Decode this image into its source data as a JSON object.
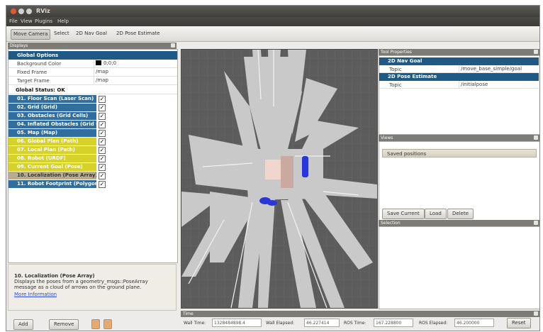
{
  "window": {
    "title": "RViz"
  },
  "menu": [
    "File",
    "View",
    "Plugins",
    "Help"
  ],
  "toolbar": [
    "Move Camera",
    "Select",
    "2D Nav Goal",
    "2D Pose Estimate"
  ],
  "displays_panel": {
    "header": "Displays",
    "global_options": {
      "label": "Global Options",
      "properties": [
        {
          "name": "Background Color",
          "value": "0;0;0",
          "color": "#000000"
        },
        {
          "name": "Fixed Frame",
          "value": "/map"
        },
        {
          "name": "Target Frame",
          "value": "/map"
        }
      ]
    },
    "global_status": "Global Status: OK",
    "items": [
      {
        "label": "01. Floor Scan (Laser Scan)",
        "checked": true,
        "color": "blue"
      },
      {
        "label": "02. Grid (Grid)",
        "checked": true,
        "color": "blue"
      },
      {
        "label": "03. Obstacles (Grid Cells)",
        "checked": true,
        "color": "blue"
      },
      {
        "label": "04. Inflated Obstacles (Grid Cells)",
        "checked": true,
        "color": "blue"
      },
      {
        "label": "05. Map (Map)",
        "checked": true,
        "color": "blue"
      },
      {
        "label": "06. Global Plan (Path)",
        "checked": true,
        "color": "yellow"
      },
      {
        "label": "07. Local Plan (Path)",
        "checked": true,
        "color": "yellow"
      },
      {
        "label": "08. Robot (URDF)",
        "checked": true,
        "color": "yellow"
      },
      {
        "label": "09. Current Goal (Pose)",
        "checked": true,
        "color": "yellow"
      },
      {
        "label": "10. Localization (Pose Array)",
        "checked": true,
        "color": "tan"
      },
      {
        "label": "11. Robot Footprint (Polygon)",
        "checked": true,
        "color": "blue"
      }
    ],
    "description": {
      "title": "10. Localization (Pose Array)",
      "text": "Displays the poses from a geometry_msgs::PoseArray message as a cloud of arrows on the ground plane.",
      "link": "More Information"
    },
    "buttons": {
      "add": "Add",
      "remove": "Remove"
    }
  },
  "tool_properties": {
    "header": "Tool Properties",
    "groups": [
      {
        "label": "2D Nav Goal",
        "row": {
          "name": "Topic",
          "value": "/move_base_simple/goal"
        }
      },
      {
        "label": "2D Pose Estimate",
        "row": {
          "name": "Topic",
          "value": "/initialpose"
        }
      }
    ]
  },
  "views_panel": {
    "header": "Views",
    "selected": "Saved positions",
    "buttons": {
      "save": "Save Current",
      "load": "Load",
      "delete": "Delete"
    }
  },
  "selection_panel": {
    "header": "Selection"
  },
  "time_panel": {
    "header": "Time",
    "fields": [
      {
        "label": "Wall Time:",
        "value": "1328484898.4"
      },
      {
        "label": "Wall Elapsed:",
        "value": "46.227414"
      },
      {
        "label": "ROS Time:",
        "value": "167.228800"
      },
      {
        "label": "ROS Elapsed:",
        "value": "46.200000"
      }
    ],
    "reset": "Reset"
  }
}
